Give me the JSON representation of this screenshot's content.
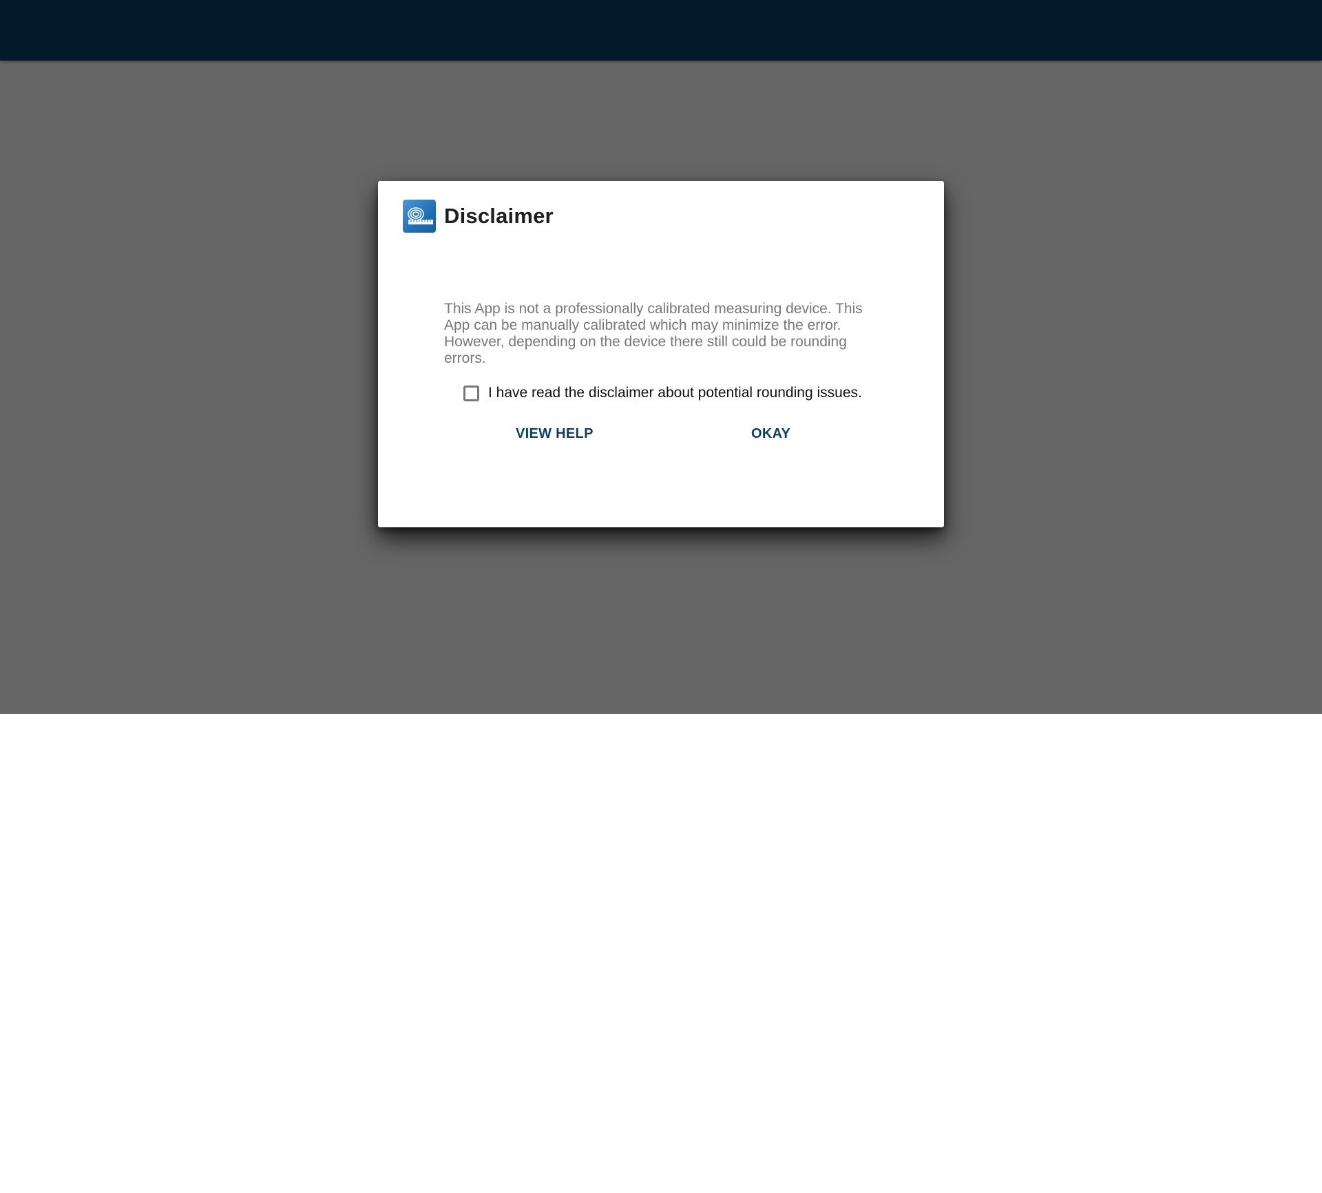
{
  "dialog": {
    "icon": "tape-measure-app-icon",
    "title": "Disclaimer",
    "message": "This App is not a professionally calibrated measuring device. This App can be manually calibrated which may minimize the error. However, depending on the device there still could be rounding errors.",
    "checkbox": {
      "label": "I have read the disclaimer about potential rounding issues.",
      "checked": false
    },
    "buttons": {
      "help_label": "VIEW HELP",
      "okay_label": "OKAY"
    }
  },
  "colors": {
    "status_bar": "#001a29",
    "scrim": "#666666",
    "accent": "#0f3f63",
    "icon_blue": "#1f6fb5"
  }
}
